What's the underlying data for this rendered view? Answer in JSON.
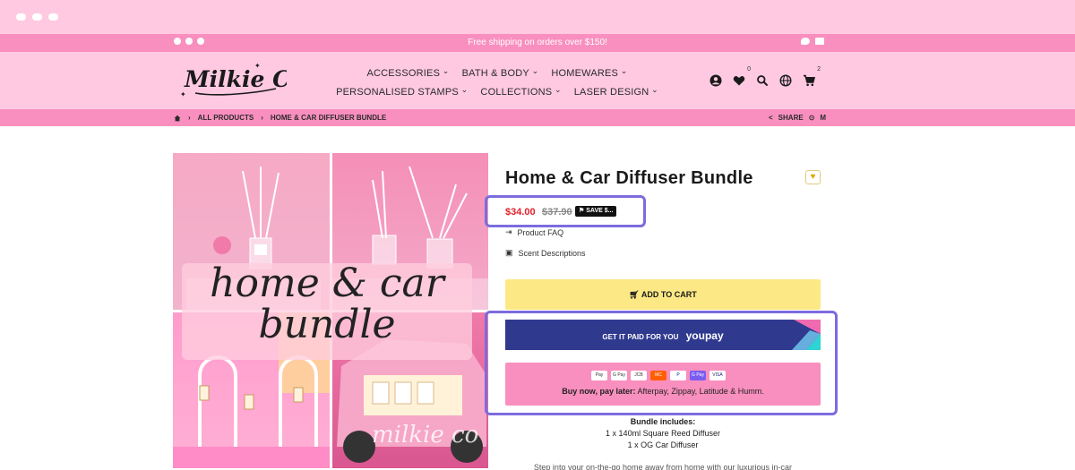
{
  "announcement": {
    "text": "Free shipping on orders over $150!"
  },
  "header": {
    "logo_text": "Milkie Co",
    "nav_row1": [
      "ACCESSORIES",
      "BATH & BODY",
      "HOMEWARES"
    ],
    "nav_row2": [
      "PERSONALISED STAMPS",
      "COLLECTIONS",
      "LASER DESIGN"
    ],
    "wishlist_count": "0",
    "cart_count": "2",
    "icons": [
      "user-icon",
      "heart-icon",
      "search-icon",
      "globe-icon",
      "cart-icon"
    ]
  },
  "breadcrumb": {
    "home_icon": "home-icon",
    "items": [
      "ALL PRODUCTS",
      "HOME & CAR DIFFUSER BUNDLE"
    ],
    "share_label": "SHARE"
  },
  "gallery": {
    "overlay_line1": "home & car",
    "overlay_line2": "bundle",
    "watermark": "milkie co"
  },
  "product": {
    "title": "Home & Car Diffuser Bundle",
    "price": "$34.00",
    "compare_price": "$37.90",
    "save_badge": "SAVE $...",
    "links": [
      "Product FAQ",
      "Scent Descriptions"
    ],
    "add_to_cart": "ADD TO CART",
    "youpay_text": "GET IT PAID FOR YOU",
    "youpay_brand": "youpay",
    "bnpl_bold": "Buy now, pay later:",
    "bnpl_rest": "Afterpay, Zippay, Latitude & Humm.",
    "payment_methods": [
      "Pay",
      "G Pay",
      "JCB",
      "MC",
      "P",
      "G Pay",
      "VISA"
    ],
    "includes_heading": "Bundle includes:",
    "includes_items": [
      "1 x 140ml Square Reed Diffuser",
      "1 x OG Car Diffuser"
    ],
    "description_start": "Step into your on-the-go home away from home with our luxurious in-car"
  },
  "colors": {
    "pink_light": "#ffc9e1",
    "pink_strip": "#f98fbf",
    "price_red": "#e0212b",
    "add_to_cart_yellow": "#fce985",
    "youpay_navy": "#2f3a8f",
    "highlight_purple": "#7c6cdd"
  }
}
